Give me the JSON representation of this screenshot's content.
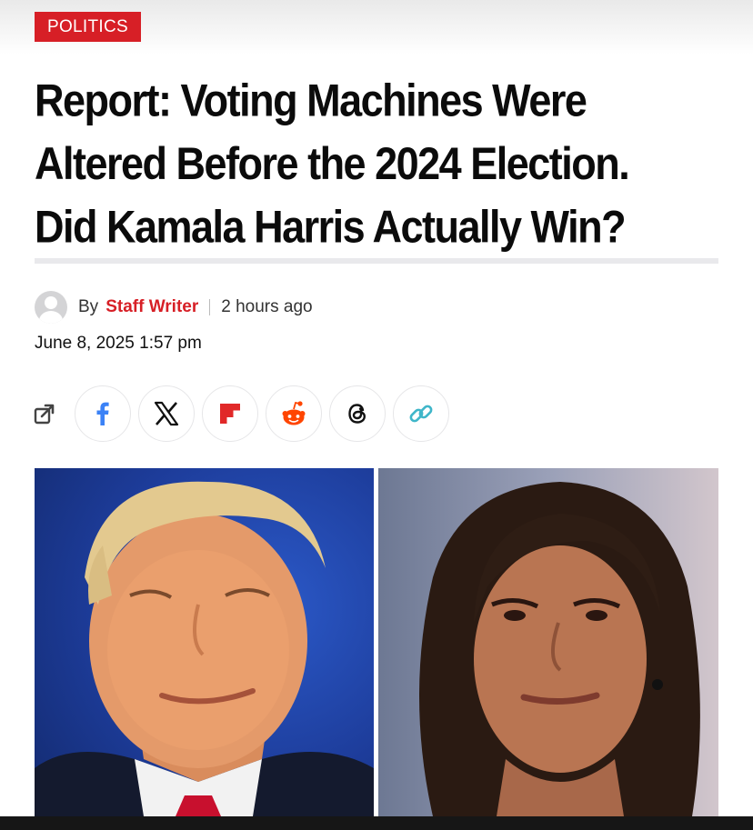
{
  "category": "POLITICS",
  "headline": {
    "line1": "Report: Voting Machines Were",
    "line2": "Altered Before the 2024 Election.",
    "line3": "Did Kamala Harris Actually Win?"
  },
  "byline": {
    "by": "By",
    "author": "Staff Writer",
    "relative_time": "2 hours ago"
  },
  "date": "June 8, 2025 1:57 pm",
  "share": {
    "icons": [
      "share-icon",
      "facebook-icon",
      "x-icon",
      "flipboard-icon",
      "reddit-icon",
      "threads-icon",
      "link-icon"
    ]
  },
  "colors": {
    "accent": "#d71f26",
    "headline": "#0b0b0b",
    "facebook": "#3b82f6",
    "flipboard": "#e12828",
    "reddit": "#ff4500",
    "link": "#3fb6c9"
  }
}
